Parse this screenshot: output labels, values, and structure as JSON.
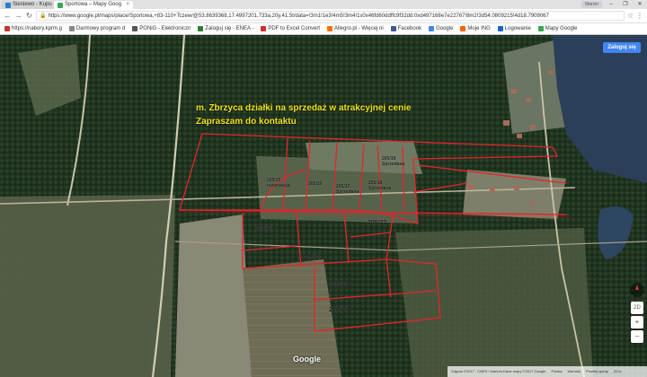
{
  "browser": {
    "tabs": [
      {
        "label": "Sieniewo - Kupu",
        "active": false
      },
      {
        "label": "Sportowa – Mapy Goog",
        "active": true
      }
    ],
    "window_controls": [
      "–",
      "❐",
      "✕"
    ],
    "user_chip": "Marcin",
    "address_url": "https://www.google.pl/maps/place/Sportowa,+83-110+Tczew/@53.8639368,17.4997201,733a,20y,41.5t/data=!3m1!1e3!4m5!3m4!1s0x46fd60ddffc9f32dd:0xd497168e7e22767!8m2!3d54.0809215!4d18.7909067",
    "bookmarks": [
      {
        "label": "https://nabory.kprm.g",
        "icon_color": "#c0392b"
      },
      {
        "label": "Darmowy program d",
        "icon_color": "#888888"
      },
      {
        "label": "PGNiG - Elektroniczn",
        "icon_color": "#555555"
      },
      {
        "label": "Zaloguj się - ENEA -",
        "icon_color": "#2e7d32"
      },
      {
        "label": "PDF to Excel Convert",
        "icon_color": "#d32f2f"
      },
      {
        "label": "Allegro.pl - Więcej ni",
        "icon_color": "#ff6f00"
      },
      {
        "label": "Facebook",
        "icon_color": "#3b5998"
      },
      {
        "label": "Google",
        "icon_color": "#4285f4"
      },
      {
        "label": "Moje ING",
        "icon_color": "#ff6200"
      },
      {
        "label": "Logowanie",
        "icon_color": "#1565c0"
      },
      {
        "label": "Mapy Google",
        "icon_color": "#34a853"
      }
    ]
  },
  "map": {
    "headline_line1": "m. Zbrzyca  działki na sprzedaż w atrakcyjnej cenie",
    "headline_line2": "Zapraszam do kontaktu",
    "headline_color": "#f2e21b",
    "parcel_outline_color": "#e8232a",
    "sign_in_label": "Zaloguj się",
    "google_logo": "Google",
    "parcels": [
      {
        "id": "205/15",
        "status": "rezerwacja"
      },
      {
        "id": "205/16",
        "status": ""
      },
      {
        "id": "205/17",
        "status": "Sprzedana"
      },
      {
        "id": "205/18",
        "status": "Sprzedana"
      },
      {
        "id": "205/19",
        "status": "Sprzedana"
      },
      {
        "id": "205/20",
        "status": ""
      },
      {
        "id": "205/21",
        "status": ""
      },
      {
        "id": "205/22",
        "status": ""
      },
      {
        "id": "205/23",
        "status": ""
      },
      {
        "id": "205/24",
        "status": ""
      }
    ],
    "footer": {
      "imagery": "Zdjęcia ©2017 , CNES / Astrium,Dane mapy ©2017 Google",
      "country": "Polska",
      "terms": "Warunki",
      "feedback": "Prześlij opinię",
      "scale": "20 m"
    },
    "controls": {
      "zoom_in": "+",
      "zoom_out": "−",
      "tilt": "2D"
    }
  }
}
